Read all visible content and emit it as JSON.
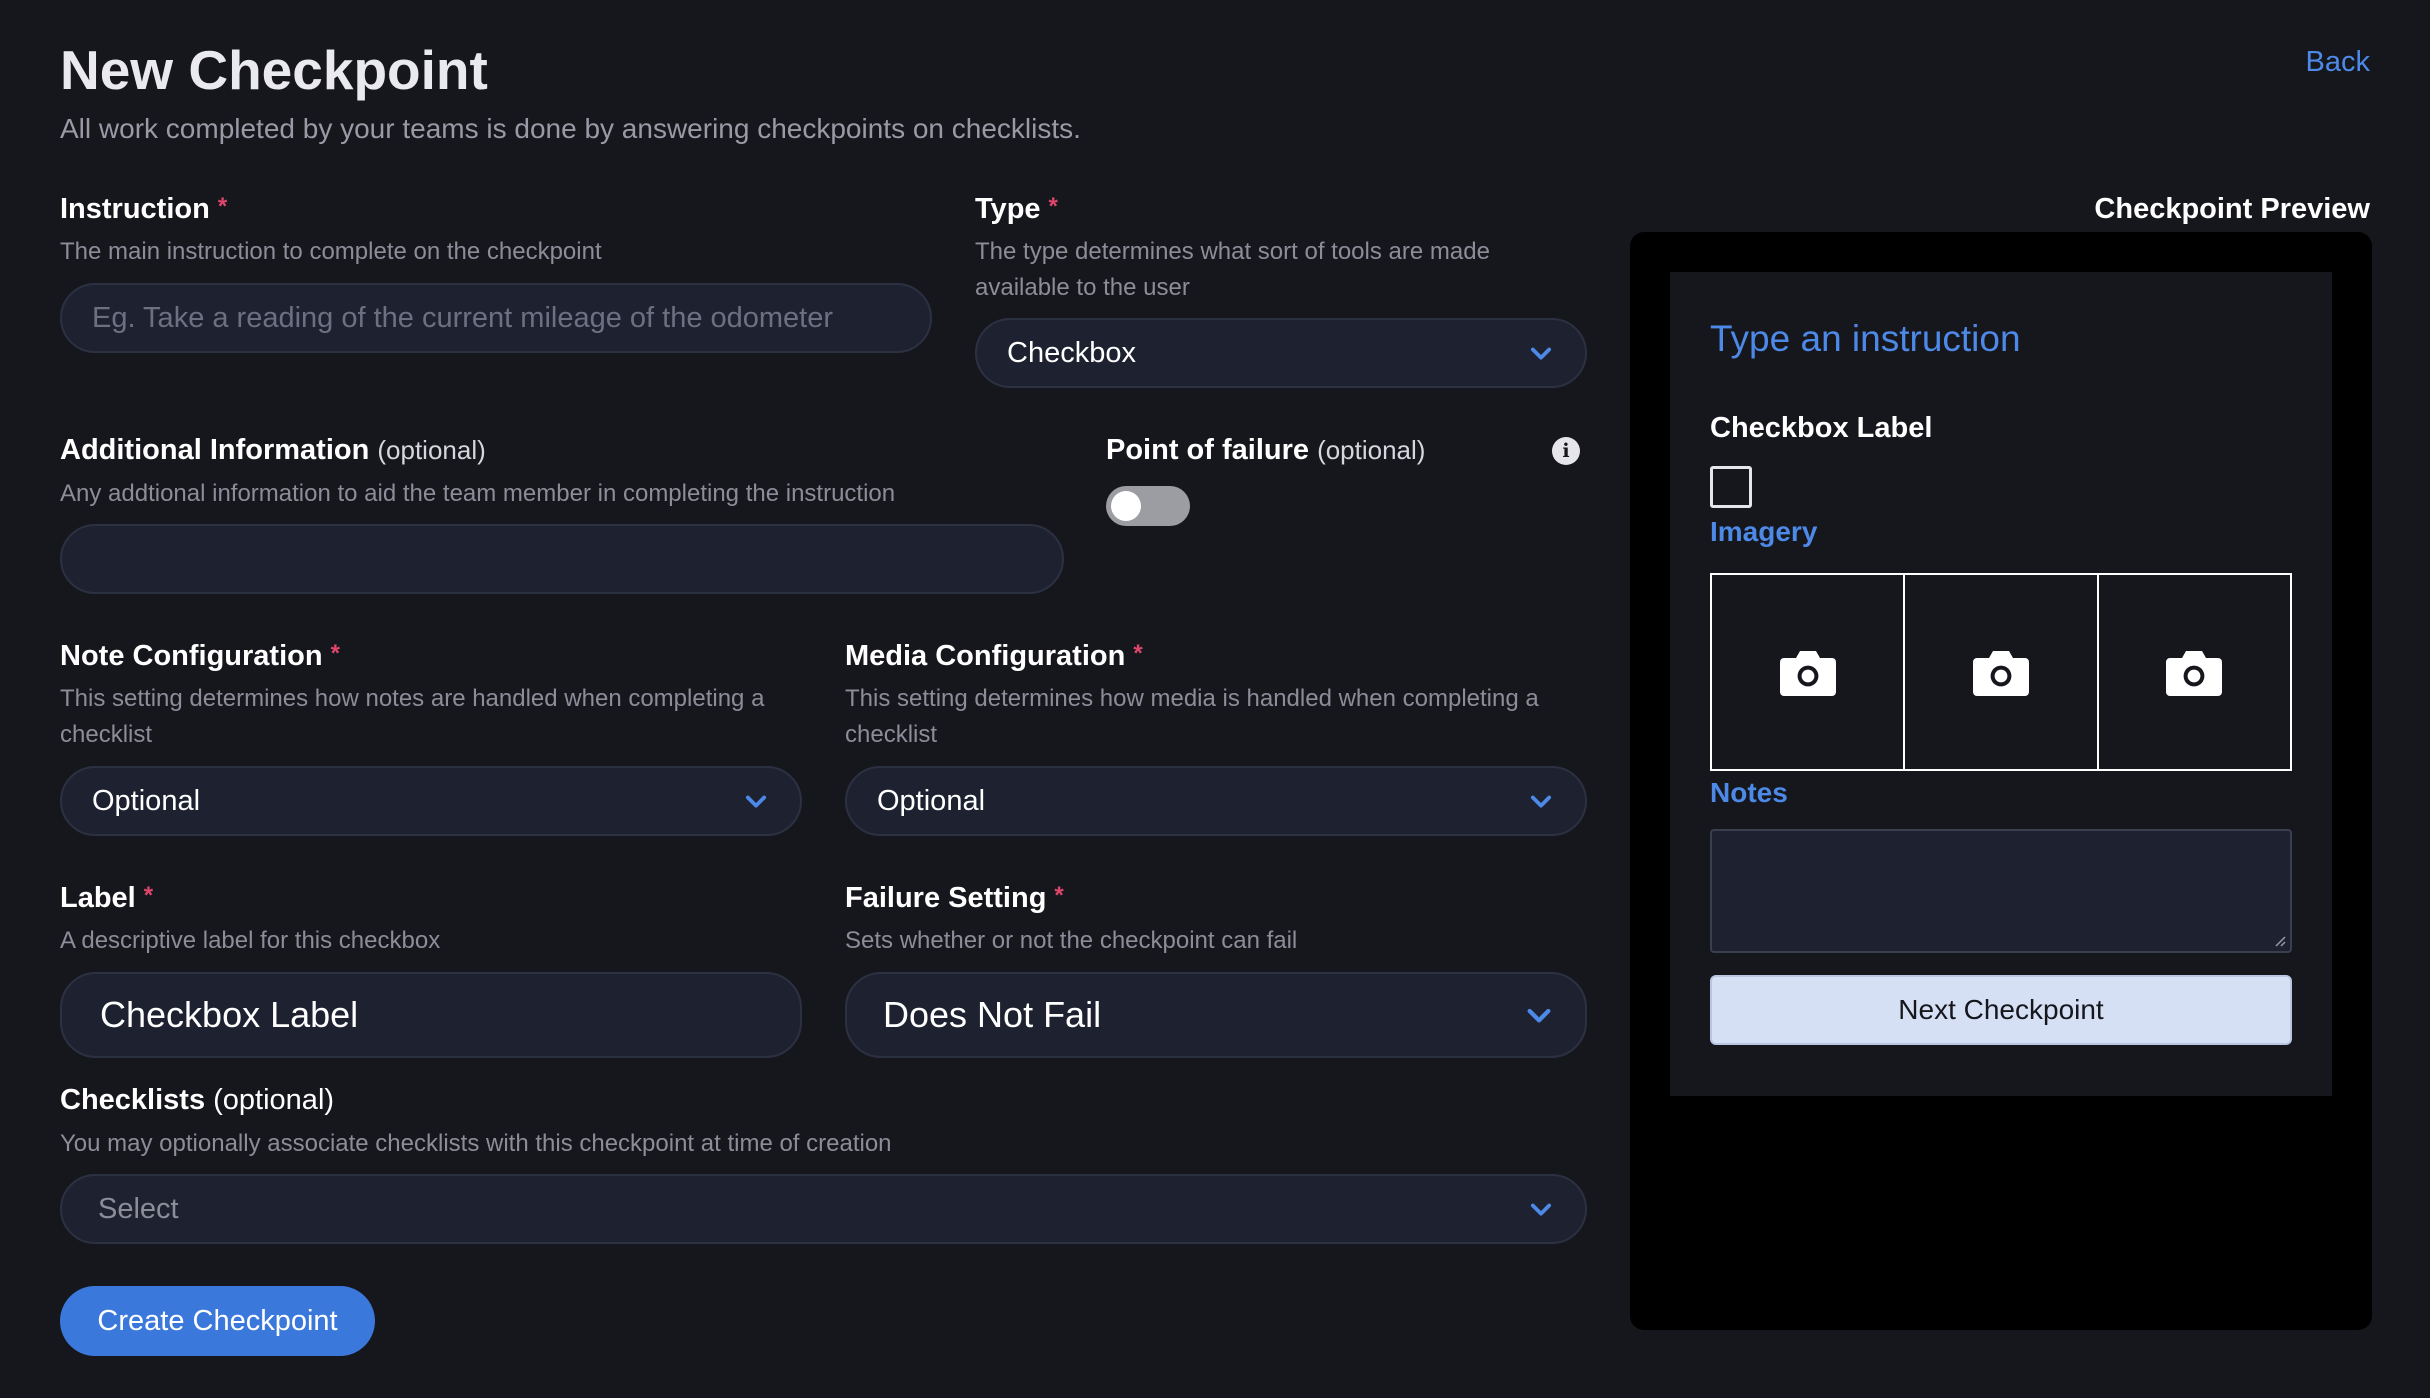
{
  "header": {
    "title": "New Checkpoint",
    "subtitle": "All work completed by your teams is done by answering checkpoints on checklists.",
    "back_label": "Back"
  },
  "form": {
    "instruction": {
      "label": "Instruction",
      "required_mark": "*",
      "help": "The main instruction to complete on the checkpoint",
      "placeholder": "Eg. Take a reading of the current mileage of the odometer",
      "value": ""
    },
    "type": {
      "label": "Type",
      "required_mark": "*",
      "help": "The type determines what sort of tools are made available to the user",
      "value": "Checkbox"
    },
    "additional_info": {
      "label": "Additional Information",
      "optional": "(optional)",
      "help": "Any addtional information to aid the team member in completing the instruction",
      "value": ""
    },
    "point_of_failure": {
      "label": "Point of failure",
      "optional": "(optional)",
      "enabled": false,
      "info_icon": "info-icon"
    },
    "note_config": {
      "label": "Note Configuration",
      "required_mark": "*",
      "help": "This setting determines how notes are handled when completing a checklist",
      "value": "Optional"
    },
    "media_config": {
      "label": "Media Configuration",
      "required_mark": "*",
      "help": "This setting determines how media is handled when completing a checklist",
      "value": "Optional"
    },
    "checkbox_label": {
      "label": "Label",
      "required_mark": "*",
      "help": "A descriptive label for this checkbox",
      "value": "Checkbox Label"
    },
    "failure_setting": {
      "label": "Failure Setting",
      "required_mark": "*",
      "help": "Sets whether or not the checkpoint can fail",
      "value": "Does Not Fail"
    },
    "checklists": {
      "label": "Checklists",
      "optional": "(optional)",
      "help": "You may optionally associate checklists with this checkpoint at time of creation",
      "placeholder": "Select"
    },
    "submit_label": "Create Checkpoint"
  },
  "preview": {
    "title": "Checkpoint Preview",
    "instruction_placeholder": "Type an instruction",
    "checkbox_label": "Checkbox Label",
    "imagery_label": "Imagery",
    "image_slots": [
      "camera-icon",
      "camera-icon",
      "camera-icon"
    ],
    "notes_label": "Notes",
    "next_label": "Next Checkpoint"
  },
  "colors": {
    "background": "#16161d",
    "accent": "#4d89e6",
    "primary_button": "#3b78dc",
    "required": "#e0466b",
    "input_bg": "#1e2230"
  }
}
